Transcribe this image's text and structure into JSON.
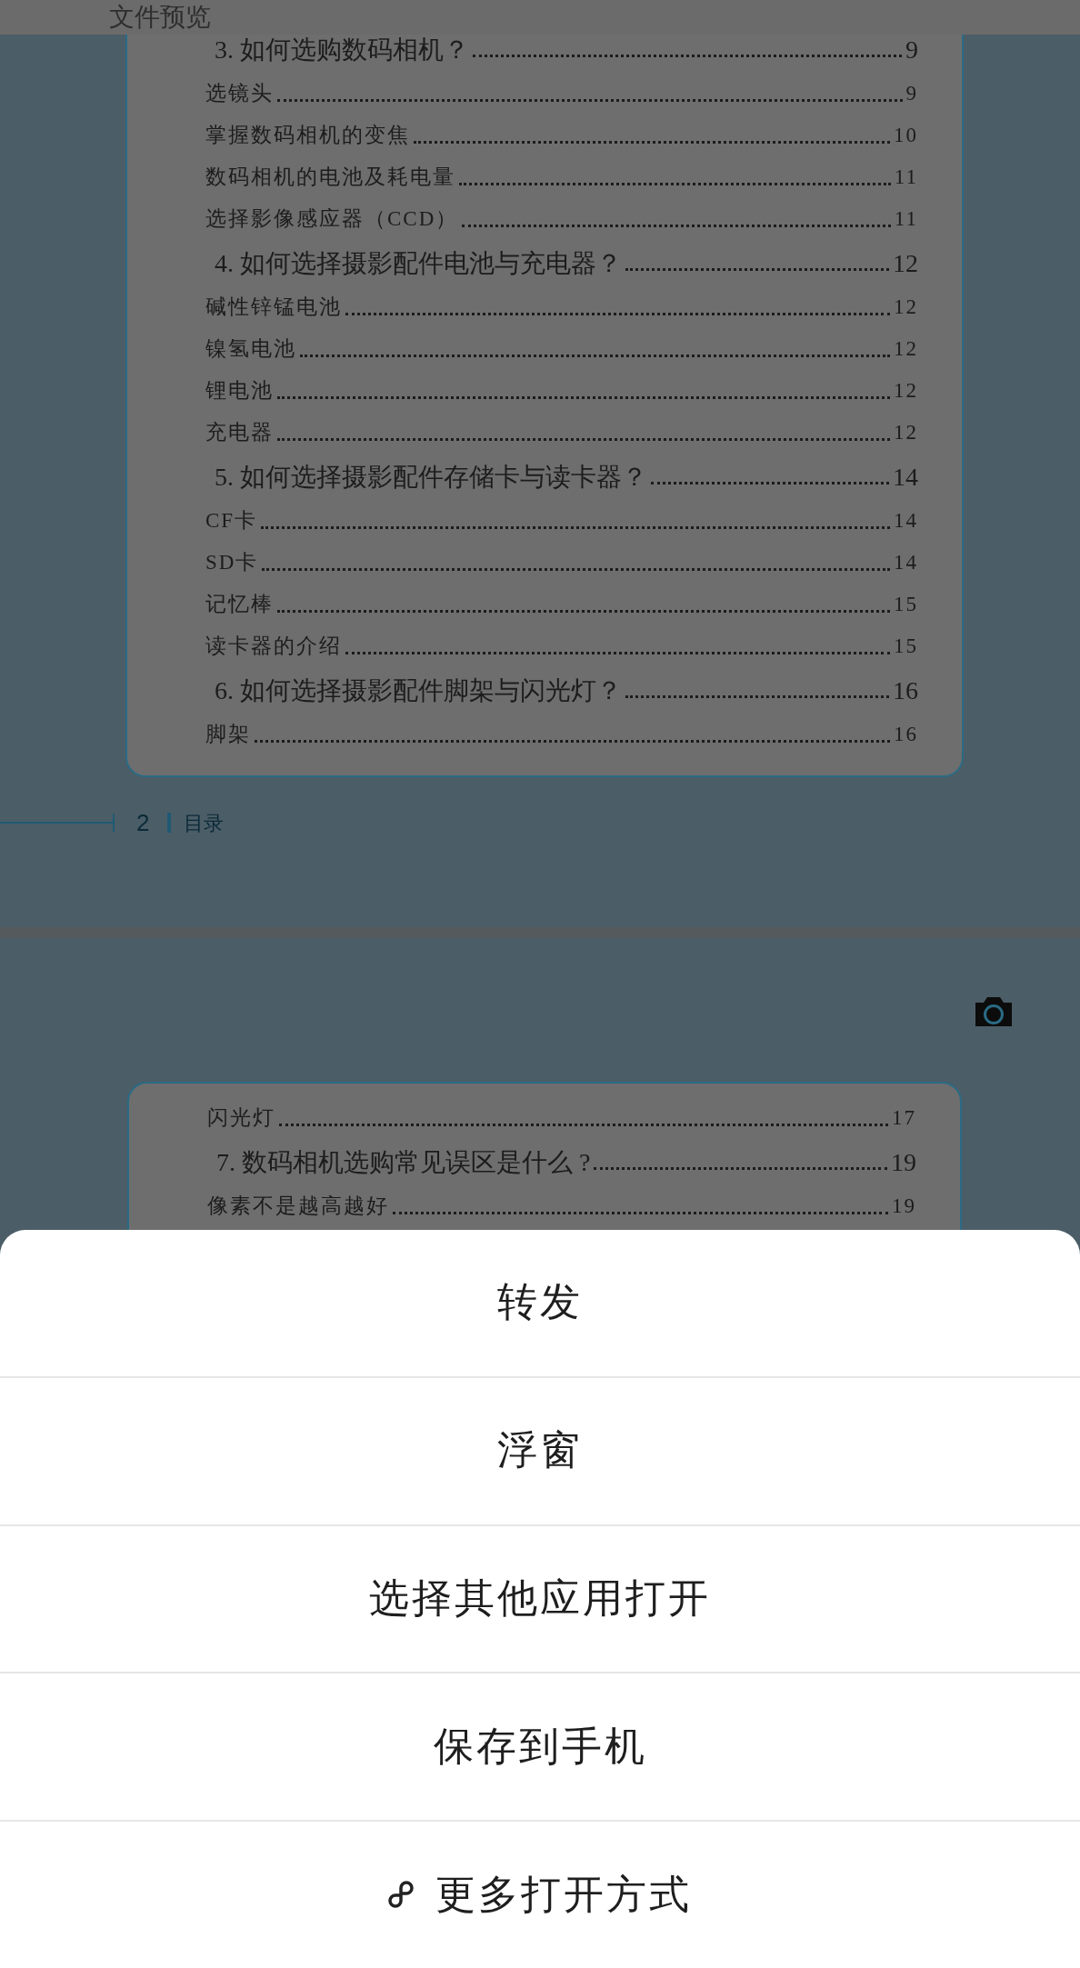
{
  "header": {
    "title": "文件预览"
  },
  "pages": [
    {
      "toc": [
        {
          "kind": "section",
          "label": "3. 如何选购数码相机？",
          "page": "9"
        },
        {
          "kind": "entry",
          "label": "选镜头",
          "page": "9"
        },
        {
          "kind": "entry",
          "label": "掌握数码相机的变焦",
          "page": "10"
        },
        {
          "kind": "entry",
          "label": "数码相机的电池及耗电量",
          "page": "11"
        },
        {
          "kind": "entry",
          "label": "选择影像感应器（CCD）",
          "page": "11"
        },
        {
          "kind": "section",
          "label": "4. 如何选择摄影配件电池与充电器？",
          "page": "12"
        },
        {
          "kind": "entry",
          "label": "碱性锌锰电池",
          "page": "12"
        },
        {
          "kind": "entry",
          "label": "镍氢电池",
          "page": "12"
        },
        {
          "kind": "entry",
          "label": "锂电池",
          "page": "12"
        },
        {
          "kind": "entry",
          "label": "充电器",
          "page": "12"
        },
        {
          "kind": "section",
          "label": "5. 如何选择摄影配件存储卡与读卡器？",
          "page": "14"
        },
        {
          "kind": "entry",
          "label": "CF卡",
          "page": "14"
        },
        {
          "kind": "entry",
          "label": "SD卡",
          "page": "14"
        },
        {
          "kind": "entry",
          "label": "记忆棒",
          "page": "15"
        },
        {
          "kind": "entry",
          "label": "读卡器的介绍",
          "page": "15"
        },
        {
          "kind": "section",
          "label": "6. 如何选择摄影配件脚架与闪光灯？",
          "page": "16"
        },
        {
          "kind": "entry",
          "label": "脚架",
          "page": "16"
        }
      ],
      "footer": {
        "page_number": "2",
        "section": "目录"
      }
    },
    {
      "toc": [
        {
          "kind": "entry",
          "label": "闪光灯",
          "page": "17"
        },
        {
          "kind": "section",
          "label": "7. 数码相机选购常见误区是什么 ?",
          "page": "19"
        },
        {
          "kind": "entry",
          "label": "像素不是越高越好",
          "page": "19"
        }
      ]
    }
  ],
  "action_sheet": {
    "items": [
      {
        "kind": "plain",
        "label": "转发"
      },
      {
        "kind": "plain",
        "label": "浮窗"
      },
      {
        "kind": "plain",
        "label": "选择其他应用打开"
      },
      {
        "kind": "plain",
        "label": "保存到手机"
      },
      {
        "kind": "link",
        "label": "更多打开方式"
      }
    ]
  }
}
